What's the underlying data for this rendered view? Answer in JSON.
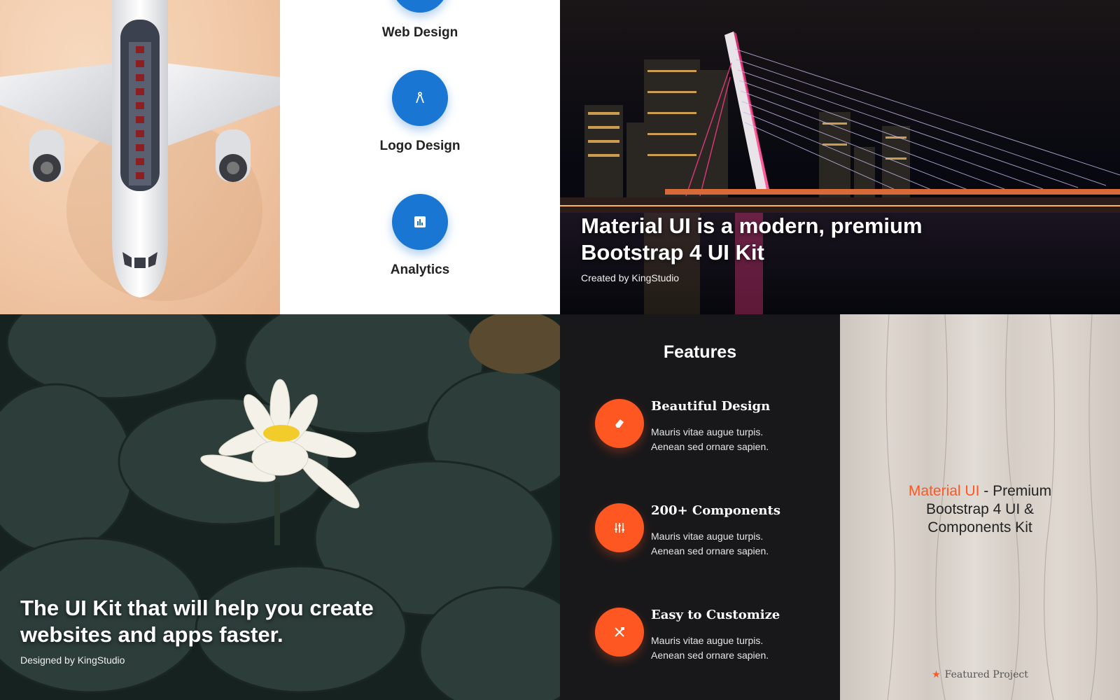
{
  "services": {
    "items": [
      {
        "label": "Web Design",
        "icon": "web-design-icon"
      },
      {
        "label": "Logo Design",
        "icon": "compass-icon"
      },
      {
        "label": "Analytics",
        "icon": "analytics-icon"
      }
    ]
  },
  "bridge_hero": {
    "title_line1": "Material UI is a modern, premium",
    "title_line2": "Bootstrap 4 UI Kit",
    "subtitle": "Created by KingStudio"
  },
  "lily_hero": {
    "title_line1": "The UI Kit that will help you create",
    "title_line2": "websites and apps faster.",
    "subtitle": "Designed by KingStudio"
  },
  "features": {
    "title": "Features",
    "items": [
      {
        "title": "Beautiful Design",
        "line1": "Mauris vitae augue turpis.",
        "line2": "Aenean sed ornare sapien.",
        "icon": "eraser-icon"
      },
      {
        "title": "200+ Components",
        "line1": "Mauris vitae augue turpis.",
        "line2": "Aenean sed ornare sapien.",
        "icon": "sliders-icon"
      },
      {
        "title": "Easy to Customize",
        "line1": "Mauris vitae augue turpis.",
        "line2": "Aenean sed ornare sapien.",
        "icon": "tools-icon"
      }
    ]
  },
  "wood_card": {
    "accent_text": "Material UI",
    "text_rest1": " - Premium",
    "text_line2": "Bootstrap 4 UI &",
    "text_line3": "Components Kit",
    "featured_label": "Featured Project",
    "featured_icon": "star-icon"
  },
  "colors": {
    "primary_blue": "#1976d2",
    "accent_orange": "#ff5722",
    "dark_bg": "#18181a"
  }
}
